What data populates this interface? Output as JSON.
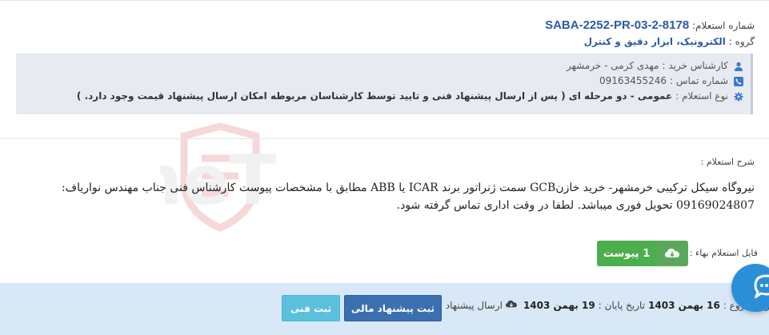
{
  "header": {
    "request_number_label": "شماره استعلام:",
    "request_number": "SABA-2252-PR-03-2-8178",
    "group_label": "گروه :",
    "group_value": "الکترونیک، ابزار دقیق و کنترل"
  },
  "info": {
    "buyer_label": "کارشناس خرید :",
    "buyer_value": "مهدی کرمی - خرمشهر",
    "phone_label": "شماره تماس :",
    "phone_value": "09163455246",
    "type_label": "نوع استعلام :",
    "type_value": "عمومی - دو مرحله ای ( پس از ارسال پیشنهاد فنی و تایید توسط کارشناسان مربوطه امکان ارسال پیشنهاد قیمت وجود دارد. )"
  },
  "description": {
    "label": "شرح استعلام :",
    "text": "نیروگاه سیکل ترکیبی خرمشهر- خرید خازنGCB سمت ژنراتور برند ICAR یا ABB مطابق با مشخصات پیوست کارشناس فنی جناب مهندس نواریاف: 09169024807 تحویل فوری میباشد. لطفا در وقت اداری تماس گرفته شود."
  },
  "file": {
    "label": "فایل استعلام بهاء :",
    "attachment_button": "1 پیوست"
  },
  "footer": {
    "start_label": "تاریخ شروع :",
    "start_date": "16 بهمن 1403",
    "end_label": "تاریخ پایان :",
    "end_date": "19 بهمن 1403",
    "send_label": "ارسال پیشنهاد :",
    "financial_button": "ثبت پیشنهاد مالی",
    "technical_button": "ثبت فنی"
  },
  "watermark": "AriaTender.neT",
  "colors": {
    "accent_blue": "#2c5c9e",
    "info_bg": "#e7eaf1",
    "footer_bg": "#d9e8f6",
    "green": "#4cae4c",
    "button_blue": "#3b6fb0",
    "button_cyan": "#5bc0de",
    "chat_blue": "#2a8fd8"
  },
  "icons": {
    "buyer": "user-icon",
    "phone": "phone-icon",
    "type": "gear-icon",
    "attachment": "cloud-download-icon",
    "send": "cloud-download-icon",
    "chat": "chat-bubble-icon"
  }
}
